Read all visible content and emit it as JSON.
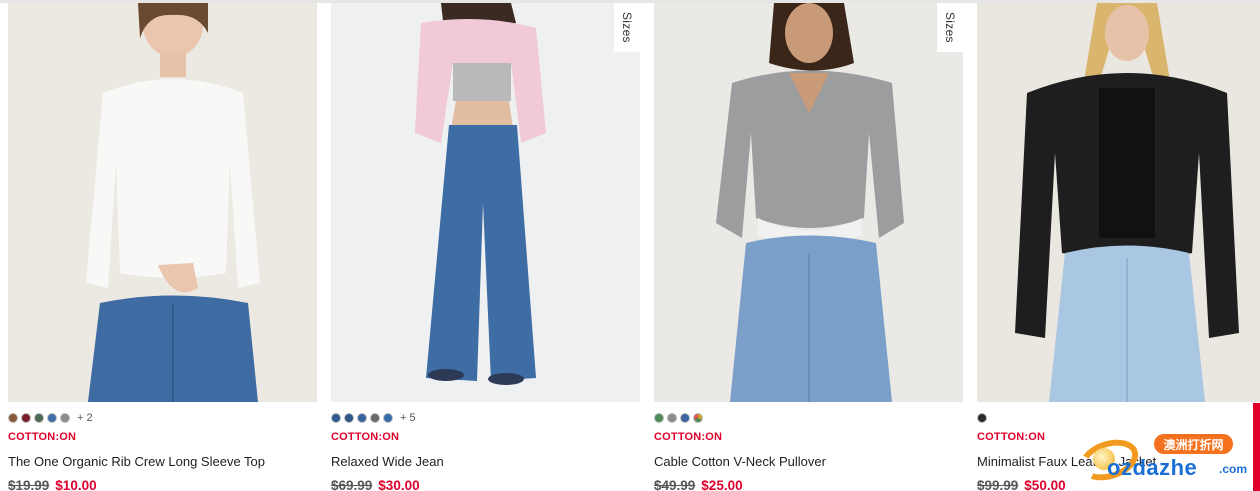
{
  "products": [
    {
      "brand": "COTTON:ON",
      "name": "The One Organic Rib Crew Long Sleeve Top",
      "old_price": "$19.99",
      "new_price": "$10.00",
      "swatches": [
        "#8a5a3c",
        "#7a1f2a",
        "#4d6b55",
        "#3e6fa8",
        "#8c8c8c"
      ],
      "more_colors": "+ 2",
      "sizes_tab": "",
      "image": {
        "background": "#ece8e2",
        "top_color": "#f8f8f6",
        "bottom_color": "#3f6ba3"
      }
    },
    {
      "brand": "COTTON:ON",
      "name": "Relaxed Wide Jean",
      "old_price": "$69.99",
      "new_price": "$30.00",
      "swatches": [
        "#2f5b8f",
        "#2c5687",
        "#3b64a0",
        "#6a6a6a",
        "#3a6ea8"
      ],
      "more_colors": "+ 5",
      "sizes_tab": "Sizes",
      "image": {
        "background": "#eef0f1",
        "top_color": "#f1c9d8",
        "bottom_color": "#3e6ca4"
      }
    },
    {
      "brand": "COTTON:ON",
      "name": "Cable Cotton V-Neck Pullover",
      "old_price": "$49.99",
      "new_price": "$25.00",
      "swatches": [
        "#4f8a5a",
        "#8c8c8c",
        "#3b64a0",
        "#c9a227"
      ],
      "more_colors": "",
      "sizes_tab": "Sizes",
      "image": {
        "background": "#ebe9e6",
        "top_color": "#9b9d9f",
        "bottom_color": "#7aa0c9"
      }
    },
    {
      "brand": "COTTON:ON",
      "name": "Minimalist Faux Leather Jacket",
      "old_price": "$99.99",
      "new_price": "$50.00",
      "swatches": [
        "#2b2b2b"
      ],
      "more_colors": "",
      "sizes_tab": "",
      "image": {
        "background": "#eae6e0",
        "top_color": "#1e1e1f",
        "bottom_color": "#a9c6e2"
      }
    }
  ],
  "watermark": {
    "bubble": "澳洲打折网",
    "main": "ozdazhe",
    "suffix": ".com"
  },
  "colors": {
    "brand_red": "#e0002b",
    "watermark_blue": "#1a6fd6",
    "watermark_orange": "#f5711d"
  }
}
